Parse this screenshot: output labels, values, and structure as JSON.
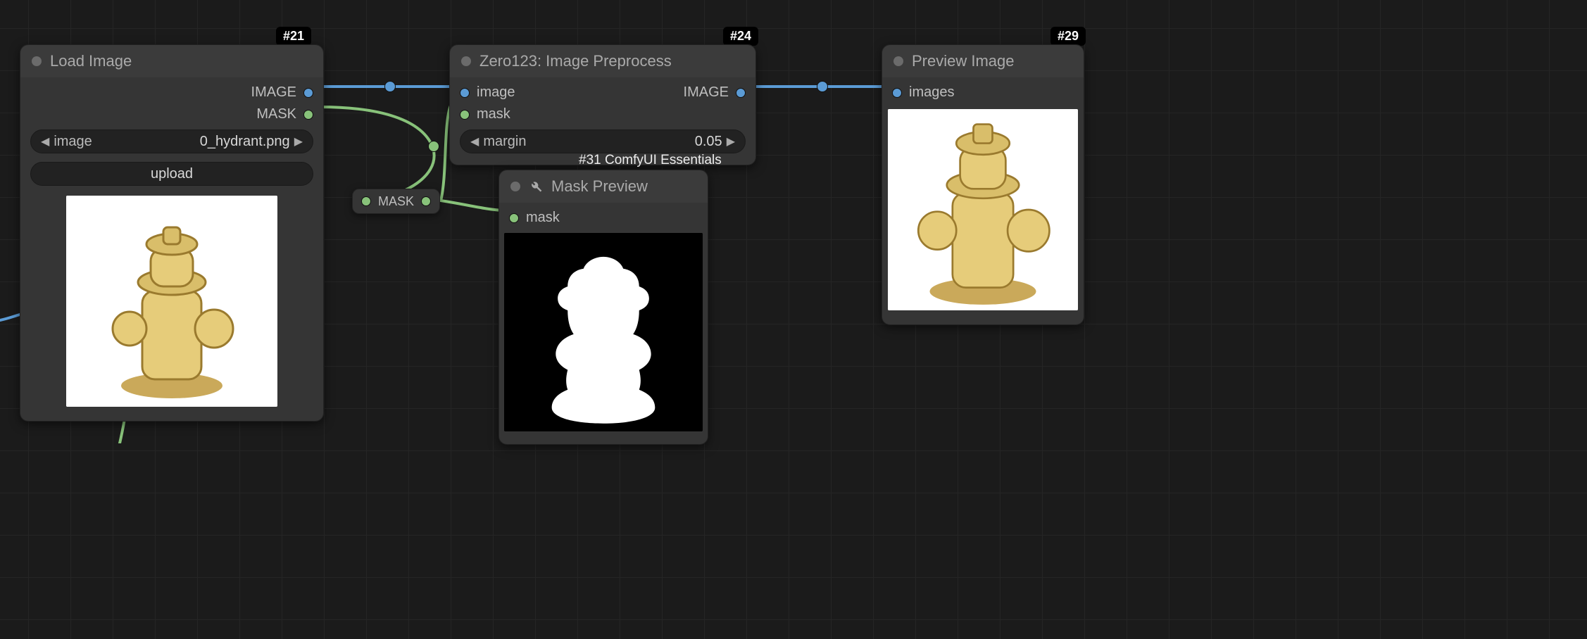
{
  "colors": {
    "blue": "#5b9bd5",
    "green": "#88c27a"
  },
  "nodes": {
    "loadImage": {
      "badge": "#21",
      "title": "Load Image",
      "outputs": {
        "image": "IMAGE",
        "mask": "MASK"
      },
      "imageWidget": {
        "label": "image",
        "value": "0_hydrant.png"
      },
      "uploadLabel": "upload"
    },
    "zero123": {
      "badge": "#24",
      "title": "Zero123: Image Preprocess",
      "inputs": {
        "image": "image",
        "mask": "mask"
      },
      "outputs": {
        "image": "IMAGE"
      },
      "marginWidget": {
        "label": "margin",
        "value": "0.05"
      }
    },
    "maskPreview": {
      "badge": "#31 ComfyUI Essentials",
      "title": "Mask Preview",
      "inputs": {
        "mask": "mask"
      }
    },
    "previewImage": {
      "badge": "#29",
      "title": "Preview Image",
      "inputs": {
        "images": "images"
      }
    },
    "rerouteMask": {
      "label": "MASK"
    }
  }
}
